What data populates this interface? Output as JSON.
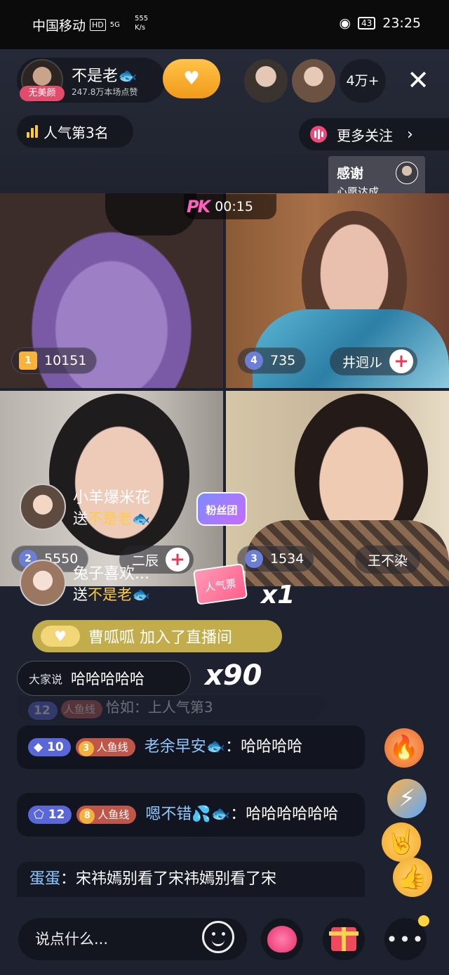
{
  "status_bar": {
    "carrier": "中国移动",
    "hd": "HD",
    "signal": "5G",
    "speed_value": "555",
    "speed_unit": "K/s",
    "battery": "43",
    "time": "23:25"
  },
  "host": {
    "tag": "无美颜",
    "name": "不是老🐟",
    "likes": "247.8万本场点赞"
  },
  "viewer_count": "4万+",
  "rank_label": "人气第3名",
  "more_follow": "更多关注",
  "thanks": {
    "title": "感谢",
    "subtitle": "心愿达成"
  },
  "pk": {
    "logo": "PK",
    "timer": "00:15"
  },
  "tiles": [
    {
      "rank": "1",
      "score": "10151"
    },
    {
      "rank": "4",
      "score": "735",
      "name": "井迥ル"
    },
    {
      "rank": "2",
      "score": "5550",
      "name": "二辰"
    },
    {
      "rank": "3",
      "score": "1534",
      "name": "王不染"
    }
  ],
  "gifts": [
    {
      "user": "小羊爆米花",
      "to_prefix": "送",
      "to_name": "不是老🐟",
      "badge": "粉丝团"
    },
    {
      "user": "兔子喜欢...",
      "to_prefix": "送",
      "to_name": "不是老🐟",
      "badge": "人气票"
    }
  ],
  "gift_combo": "x1",
  "join_notice": "曹呱呱 加入了直播间",
  "combo": {
    "label": "大家说",
    "text": "哈哈哈哈哈",
    "count": "x90"
  },
  "chat": [
    {
      "level": "10",
      "fan_level": "3",
      "fan_club": "人鱼线",
      "user": "老余早安🐟",
      "text": "：哈哈哈哈"
    },
    {
      "level": "12",
      "fan_level": "8",
      "fan_club": "人鱼线",
      "user": "嗯不错💦🐟",
      "text": "：哈哈哈哈哈哈"
    }
  ],
  "chat_faded": {
    "level": "12",
    "fan_club": "人鱼线",
    "text": "恰如：上人气第3"
  },
  "last_message": {
    "user": "蛋蛋",
    "text": "：宋祎嫣别看了宋祎嫣别看了宋"
  },
  "bottom": {
    "input_placeholder": "说点什么..."
  },
  "icons": [
    "eye-icon",
    "close-icon",
    "bars-icon",
    "heart-icon",
    "gift-icon",
    "smile-icon",
    "more-icon"
  ],
  "colors": {
    "accent": "#f7b33a",
    "pink": "#ea3950",
    "chat_bg": "#0f111a"
  }
}
